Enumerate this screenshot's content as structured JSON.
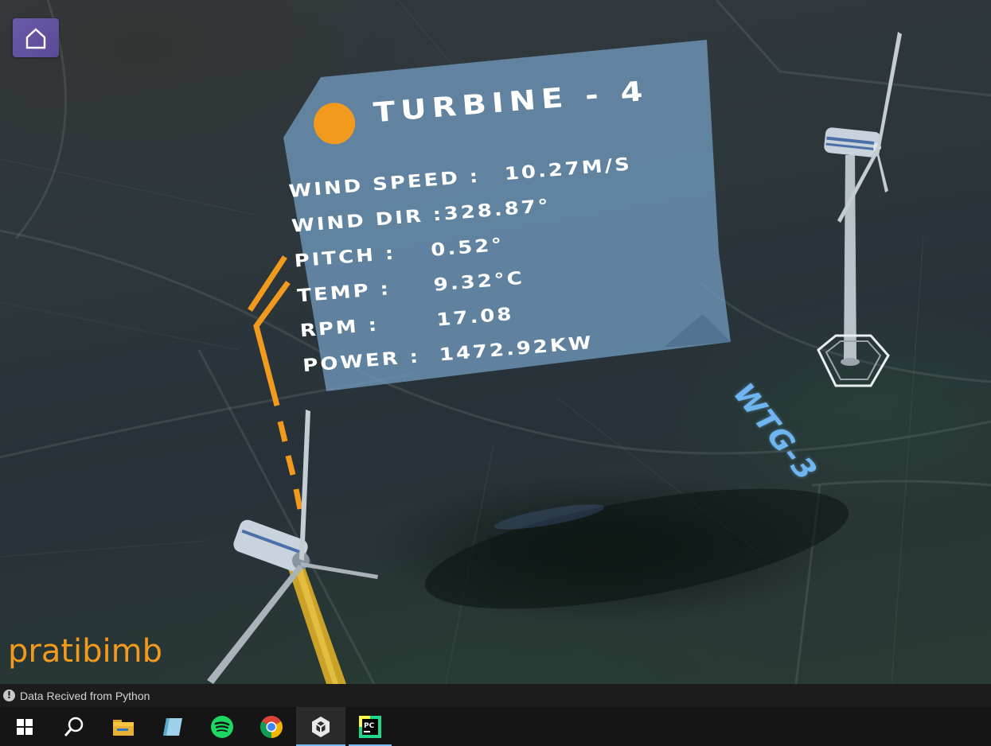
{
  "app": {
    "home_icon": "home-icon",
    "brand": "pratibimb"
  },
  "panel": {
    "status_color": "#f19a1d",
    "title": "TURBINE - 4",
    "stats": [
      {
        "label": "WIND SPEED :",
        "value": "10.27m/s"
      },
      {
        "label": "WIND DIR :",
        "value": "328.87°"
      },
      {
        "label": "PITCH :",
        "value": "0.52°"
      },
      {
        "label": "TEMP :",
        "value": "9.32°C"
      },
      {
        "label": "RPM :",
        "value": "17.08"
      },
      {
        "label": "POWER :",
        "value": "1472.92KW"
      }
    ]
  },
  "scene": {
    "wtg_label": "WTG-3"
  },
  "status_bar": {
    "icon": "exclamation-icon",
    "message": "Data Recived from Python"
  },
  "taskbar": {
    "items": [
      {
        "name": "windows-start",
        "icon": "windows-icon"
      },
      {
        "name": "search",
        "icon": "search-icon"
      },
      {
        "name": "file-explorer",
        "icon": "folder-icon"
      },
      {
        "name": "app",
        "icon": "notebook-icon"
      },
      {
        "name": "spotify",
        "icon": "spotify-icon"
      },
      {
        "name": "chrome",
        "icon": "chrome-icon"
      },
      {
        "name": "unity",
        "icon": "unity-icon",
        "state": "active"
      },
      {
        "name": "pycharm",
        "icon": "pycharm-icon",
        "state": "running"
      }
    ]
  },
  "colors": {
    "accent_orange": "#f19a1d",
    "panel_blue": "#6f98bd",
    "wtg_blue": "#6fb6f0",
    "home_purple": "#6c5aa8"
  }
}
